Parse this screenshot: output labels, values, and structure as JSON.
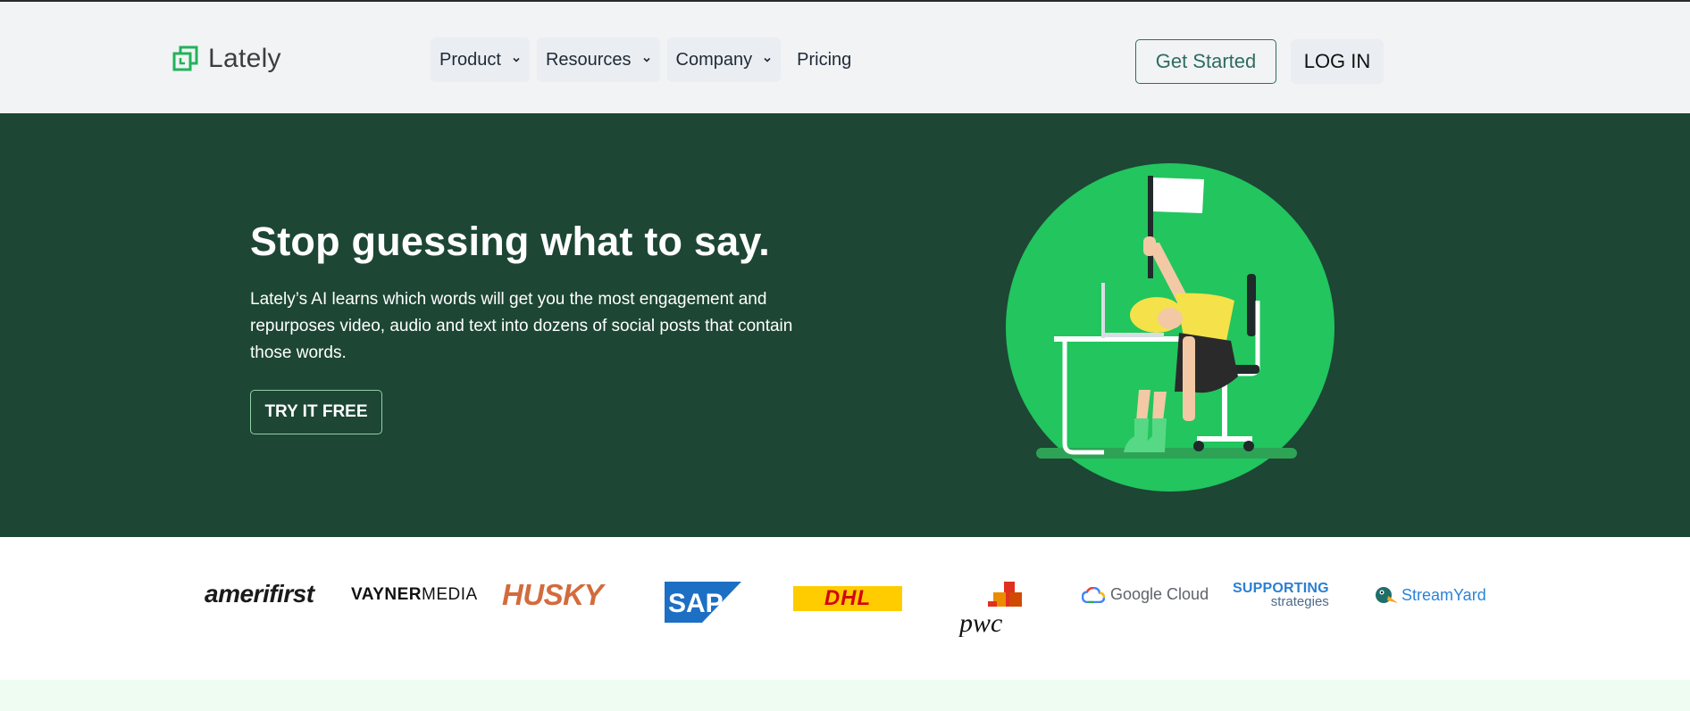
{
  "brand": {
    "name": "Lately"
  },
  "nav": {
    "items": [
      {
        "label": "Product",
        "dropdown": true
      },
      {
        "label": "Resources",
        "dropdown": true
      },
      {
        "label": "Company",
        "dropdown": true
      },
      {
        "label": "Pricing",
        "dropdown": false
      }
    ]
  },
  "header_actions": {
    "get_started": "Get Started",
    "login": "LOG IN"
  },
  "hero": {
    "title": "Stop guessing what to say.",
    "description": "Lately’s AI learns which words will get you the most engagement and repurposes video, audio and text into dozens of social posts that contain those words.",
    "cta": "TRY IT FREE"
  },
  "logos": {
    "amerifirst": "amerifirst",
    "vayner_a": "VAYNER",
    "vayner_b": "MEDIA",
    "husky": "HUSKY",
    "sap": "SAP",
    "dhl": "DHL",
    "pwc": "pwc",
    "google_cloud": "Google Cloud",
    "supporting_1": "SUPPORTING",
    "supporting_2": "strategies",
    "streamyard": "StreamYard"
  },
  "colors": {
    "header_bg": "#f1f3f4",
    "hero_bg": "#1d4634",
    "accent_green": "#22c55e",
    "button_outline": "#2f6b63"
  }
}
